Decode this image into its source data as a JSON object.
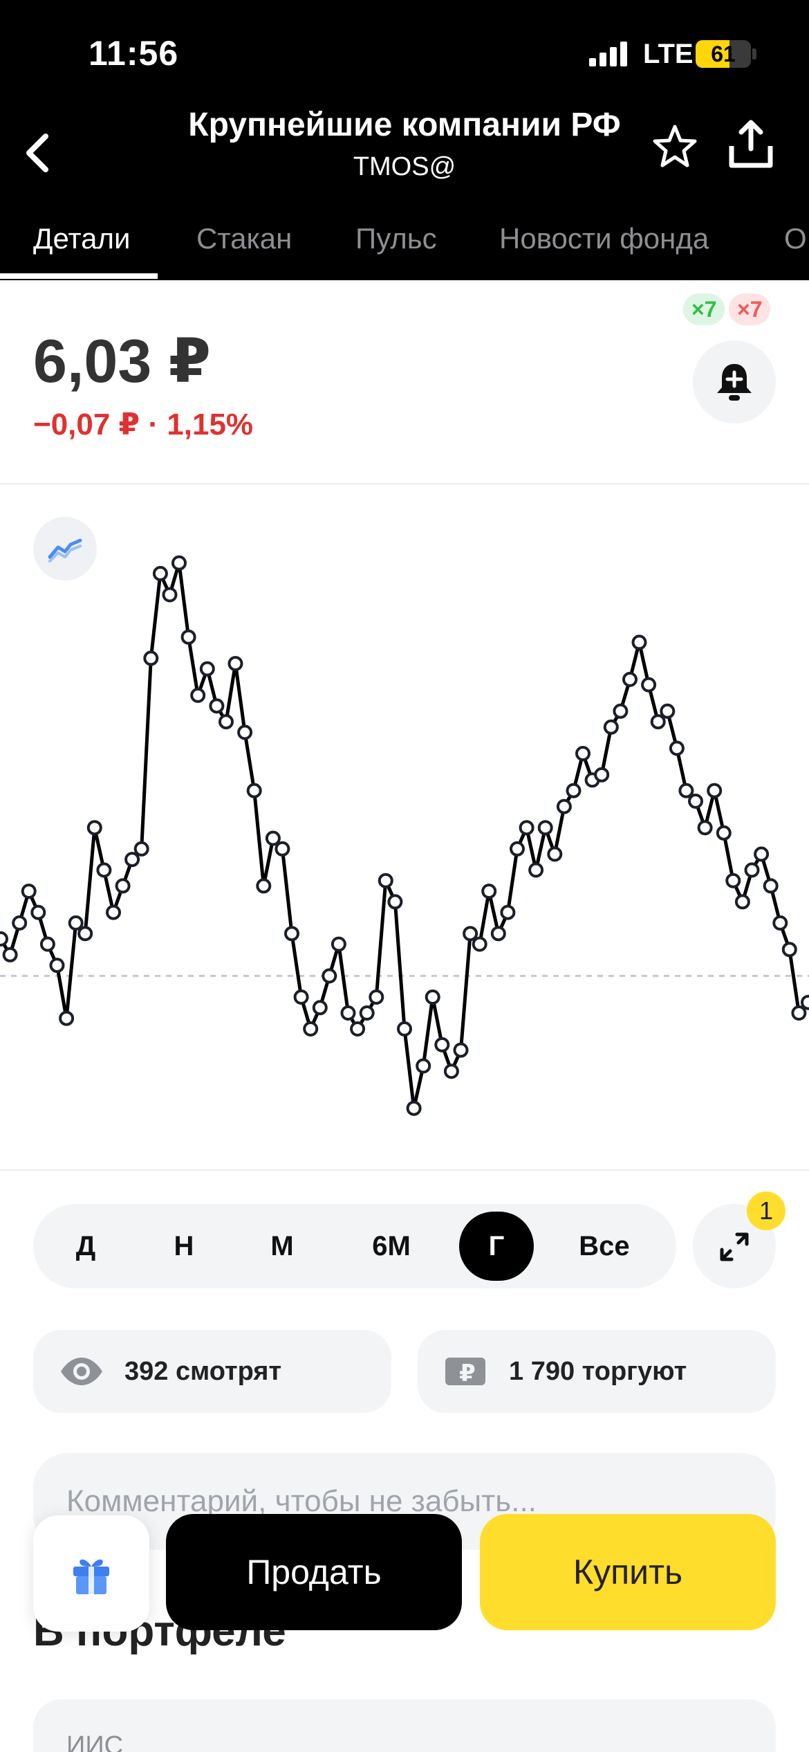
{
  "status_bar": {
    "time": "11:56",
    "network": "LTE",
    "battery": "61",
    "battery_level": 0.61
  },
  "header": {
    "title": "Крупнейшие компании РФ",
    "ticker": "TMOS@",
    "icons": [
      "chevron-left-icon",
      "star-icon",
      "share-icon"
    ]
  },
  "tabs": [
    {
      "label": "Детали",
      "active": true
    },
    {
      "label": "Стакан",
      "active": false
    },
    {
      "label": "Пульс",
      "active": false
    },
    {
      "label": "Новости фонда",
      "active": false
    },
    {
      "label": "О",
      "active": false
    }
  ],
  "quote": {
    "price": "6,03 ₽",
    "change": "−0,07 ₽ · 1,15%",
    "badge_up": "×7",
    "badge_down": "×7"
  },
  "colors": {
    "accent": "#ffdd2d",
    "negative": "#e03131",
    "positive": "#2fbf47",
    "line": "#000000"
  },
  "chart_data": {
    "type": "line",
    "series": [
      {
        "values": [
          6.17,
          6.14,
          6.2,
          6.26,
          6.22,
          6.16,
          6.12,
          6.02,
          6.2,
          6.18,
          6.38,
          6.3,
          6.22,
          6.27,
          6.32,
          6.34,
          6.7,
          6.86,
          6.82,
          6.88,
          6.74,
          6.63,
          6.68,
          6.61,
          6.58,
          6.69,
          6.56,
          6.45,
          6.27,
          6.36,
          6.34,
          6.18,
          6.06,
          6.0,
          6.04,
          6.1,
          6.16,
          6.03,
          6.0,
          6.03,
          6.06,
          6.28,
          6.24,
          6.0,
          5.85,
          5.93,
          6.06,
          5.97,
          5.92,
          5.96,
          6.18,
          6.16,
          6.26,
          6.18,
          6.22,
          6.34,
          6.38,
          6.3,
          6.38,
          6.33,
          6.42,
          6.45,
          6.52,
          6.47,
          6.48,
          6.57,
          6.6,
          6.66,
          6.73,
          6.65,
          6.58,
          6.6,
          6.53,
          6.45,
          6.43,
          6.38,
          6.45,
          6.37,
          6.28,
          6.24,
          6.3,
          6.33,
          6.27,
          6.2,
          6.15,
          6.03,
          6.05
        ]
      }
    ],
    "reference_value": 6.1,
    "ylim": [
      5.8,
      6.95
    ],
    "grid": false,
    "legend": "none"
  },
  "periods": [
    {
      "label": "Д",
      "active": false
    },
    {
      "label": "Н",
      "active": false
    },
    {
      "label": "М",
      "active": false
    },
    {
      "label": "6М",
      "active": false
    },
    {
      "label": "Г",
      "active": true
    },
    {
      "label": "Все",
      "active": false
    }
  ],
  "expand_badge": "1",
  "stats": {
    "watching": "392 смотрят",
    "trading": "1 790 торгуют"
  },
  "comment": {
    "placeholder": "Комментарий, чтобы не забыть..."
  },
  "portfolio": {
    "title": "В портфеле",
    "account": "ИИС"
  },
  "actions": {
    "sell": "Продать",
    "buy": "Купить"
  }
}
